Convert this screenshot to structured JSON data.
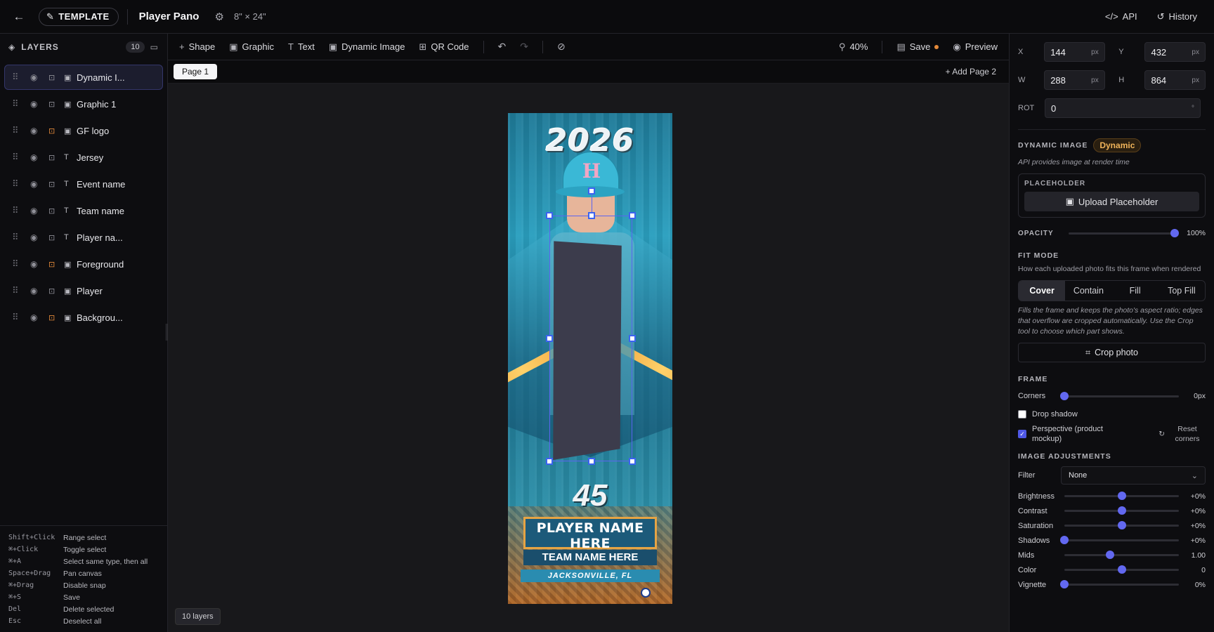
{
  "topbar": {
    "template_label": "TEMPLATE",
    "title": "Player Pano",
    "size": "8\" × 24\"",
    "api_label": "API",
    "history_label": "History"
  },
  "layers": {
    "heading": "LAYERS",
    "count": "10",
    "items": [
      {
        "name": "Dynamic I...",
        "type": "image",
        "locked": false,
        "selected": true
      },
      {
        "name": "Graphic 1",
        "type": "image",
        "locked": false
      },
      {
        "name": "GF logo",
        "type": "image",
        "locked": true
      },
      {
        "name": "Jersey",
        "type": "text",
        "locked": false
      },
      {
        "name": "Event name",
        "type": "text",
        "locked": false
      },
      {
        "name": "Team name",
        "type": "text",
        "locked": false
      },
      {
        "name": "Player na...",
        "type": "text",
        "locked": false
      },
      {
        "name": "Foreground",
        "type": "image",
        "locked": true
      },
      {
        "name": "Player",
        "type": "image",
        "locked": false
      },
      {
        "name": "Backgrou...",
        "type": "image",
        "locked": true
      }
    ],
    "shortcuts": [
      {
        "key": "Shift+Click",
        "desc": "Range select"
      },
      {
        "key": "⌘+Click",
        "desc": "Toggle select"
      },
      {
        "key": "⌘+A",
        "desc": "Select same type, then all"
      },
      {
        "key": "Space+Drag",
        "desc": "Pan canvas"
      },
      {
        "key": "⌘+Drag",
        "desc": "Disable snap"
      },
      {
        "key": "⌘+S",
        "desc": "Save"
      },
      {
        "key": "Del",
        "desc": "Delete selected"
      },
      {
        "key": "Esc",
        "desc": "Deselect all"
      }
    ]
  },
  "toolbar": {
    "shape": "Shape",
    "graphic": "Graphic",
    "text": "Text",
    "dynamic_image": "Dynamic Image",
    "qr_code": "QR Code",
    "zoom": "40%",
    "save": "Save",
    "preview": "Preview"
  },
  "pages": {
    "current": "Page 1",
    "add": "+ Add Page 2"
  },
  "canvas": {
    "layers_pill": "10 layers",
    "design": {
      "year": "2026",
      "cap_letter": "H",
      "jersey_number": "45",
      "player_name": "PLAYER NAME HERE",
      "team_name": "TEAM NAME HERE",
      "city": "JACKSONVILLE, FL"
    }
  },
  "props": {
    "x_label": "X",
    "x": "144",
    "y_label": "Y",
    "y": "432",
    "w_label": "W",
    "w": "288",
    "h_label": "H",
    "h": "864",
    "rot_label": "ROT",
    "rot": "0",
    "unit_px": "px",
    "unit_deg": "°",
    "dynamic_title": "DYNAMIC IMAGE",
    "dynamic_badge": "Dynamic",
    "dynamic_hint": "API provides image at render time",
    "placeholder_label": "PLACEHOLDER",
    "upload_placeholder": "Upload Placeholder",
    "opacity_label": "OPACITY",
    "opacity_value": "100%",
    "opacity": 1.0,
    "fit_mode_title": "FIT MODE",
    "fit_mode_desc": "How each uploaded photo fits this frame when rendered",
    "fit_modes": [
      "Cover",
      "Contain",
      "Fill",
      "Top Fill"
    ],
    "fit_active": "Cover",
    "cover_desc": "Fills the frame and keeps the photo's aspect ratio; edges that overflow are cropped automatically. Use the Crop tool to choose which part shows.",
    "crop_photo": "Crop photo",
    "frame_title": "FRAME",
    "corners_label": "Corners",
    "corners_value": "0px",
    "drop_shadow": "Drop shadow",
    "perspective": "Perspective (product mockup)",
    "reset_corners": "Reset corners",
    "image_adj_title": "IMAGE ADJUSTMENTS",
    "filter_label": "Filter",
    "filter_value": "None",
    "adjustments": [
      {
        "label": "Brightness",
        "value": "+0%",
        "pos": 0.5
      },
      {
        "label": "Contrast",
        "value": "+0%",
        "pos": 0.5
      },
      {
        "label": "Saturation",
        "value": "+0%",
        "pos": 0.5
      },
      {
        "label": "Shadows",
        "value": "+0%",
        "pos": 0.0
      },
      {
        "label": "Mids",
        "value": "1.00",
        "pos": 0.4
      },
      {
        "label": "Color",
        "value": "0",
        "pos": 0.5
      },
      {
        "label": "Vignette",
        "value": "0%",
        "pos": 0.0
      }
    ]
  }
}
